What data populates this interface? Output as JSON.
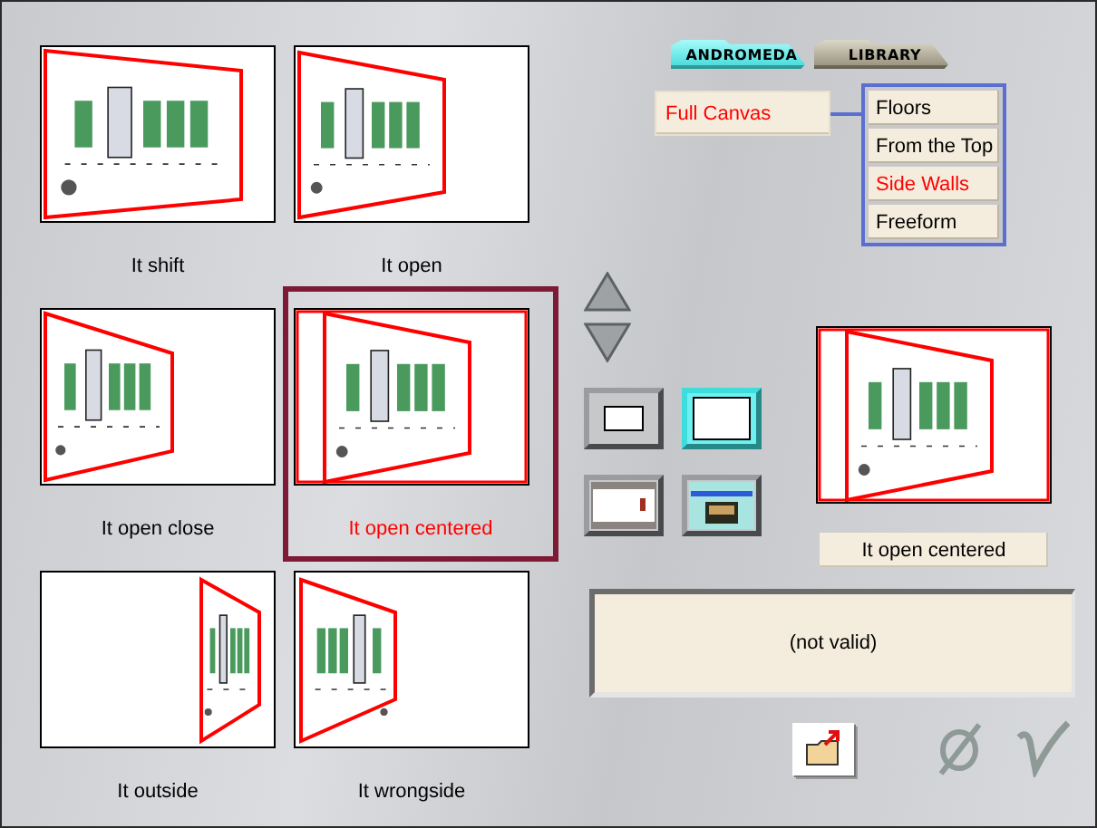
{
  "thumbnails": [
    {
      "label": "It shift",
      "kind": "shift",
      "selected": false
    },
    {
      "label": "It open",
      "kind": "open",
      "selected": false
    },
    {
      "label": "It open close",
      "kind": "open_close",
      "selected": false
    },
    {
      "label": "It open centered",
      "kind": "open_centered",
      "selected": true
    },
    {
      "label": "It outside",
      "kind": "outside",
      "selected": false
    },
    {
      "label": "It wrongside",
      "kind": "wrongside",
      "selected": false
    }
  ],
  "tabs": [
    {
      "label": "ANDROMEDA",
      "selected": true
    },
    {
      "label": "LIBRARY",
      "selected": false
    }
  ],
  "mode": {
    "label": "Full Canvas",
    "selected": true
  },
  "mode_options": [
    {
      "label": "Floors",
      "selected": false
    },
    {
      "label": "From the Top",
      "selected": false
    },
    {
      "label": "Side Walls",
      "selected": true
    },
    {
      "label": "Freeform",
      "selected": false
    }
  ],
  "view_buttons": [
    {
      "kind": "small_frame",
      "selected": false
    },
    {
      "kind": "large_frame",
      "selected": true
    },
    {
      "kind": "thumbnail",
      "selected": false
    },
    {
      "kind": "picture",
      "selected": false
    }
  ],
  "preview": {
    "kind": "open_centered",
    "name": "It open centered"
  },
  "message": "(not valid)"
}
